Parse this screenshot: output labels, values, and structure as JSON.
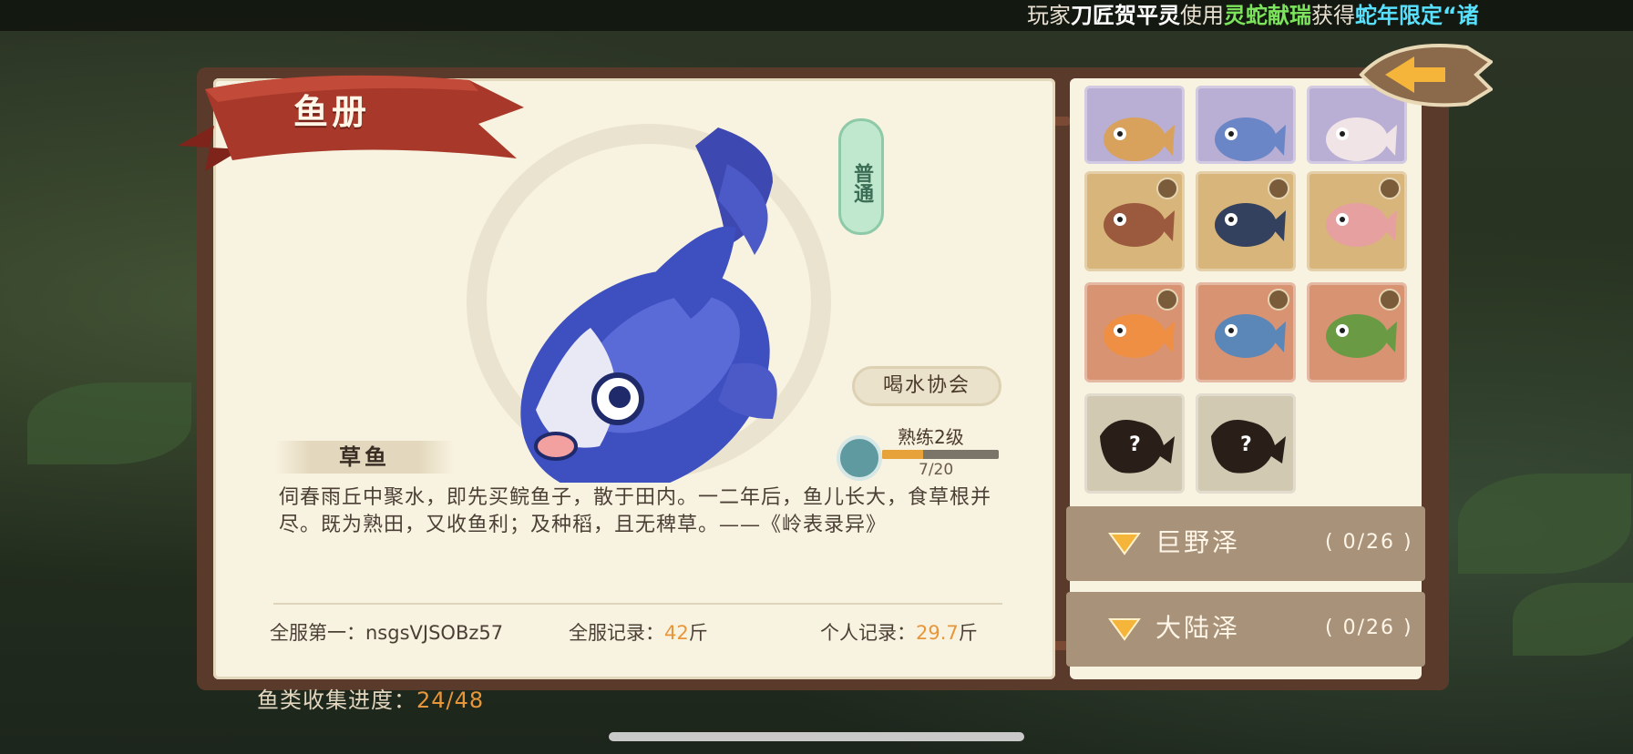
{
  "ticker": {
    "prefix": "玩家",
    "player": "刀匠贺平灵",
    "action": "使用",
    "item": "灵蛇献瑞",
    "gain": "获得",
    "reward": "蛇年限定“诸"
  },
  "book": {
    "title": "鱼册"
  },
  "fish": {
    "name": "草鱼",
    "rarity": "普通",
    "association": "喝水协会",
    "proficiency_label": "熟练2级",
    "proficiency_count": "7/20",
    "proficiency_fraction": 0.35,
    "description": "伺春雨丘中聚水，即先买鲩鱼子，散于田内。一二年后，鱼儿长大，食草根并尽。既为熟田，又收鱼利；及种稻，且无稗草。——《岭表录异》"
  },
  "stats": {
    "server_first_label": "全服第一：",
    "server_first_value": "nsgsVJSOBz57",
    "server_record_label": "全服记录：",
    "server_record_value": "42",
    "server_record_unit": "斤",
    "personal_record_label": "个人记录：",
    "personal_record_value": "29.7",
    "personal_record_unit": "斤"
  },
  "collection": {
    "label": "鱼类收集进度：",
    "value": "24/48"
  },
  "grid": {
    "cells": [
      {
        "color": "purple",
        "icon": "fish-red-lips-icon"
      },
      {
        "color": "purple",
        "icon": "fish-blue-shark-icon"
      },
      {
        "color": "purple",
        "icon": "fish-white-fox-icon"
      },
      {
        "color": "gold",
        "icon": "fish-brown-carp-icon",
        "eye": true
      },
      {
        "color": "gold",
        "icon": "fish-dark-whale-icon",
        "eye": true
      },
      {
        "color": "gold",
        "icon": "fish-dragon-icon",
        "eye": true
      },
      {
        "color": "red",
        "icon": "fish-orange-koi-icon",
        "eye": true
      },
      {
        "color": "red",
        "icon": "fish-blue-catfish-icon",
        "eye": true
      },
      {
        "color": "red",
        "icon": "fish-green-frog-icon",
        "eye": true
      },
      {
        "color": "unknown",
        "icon": "unknown-fish-icon",
        "text": "?"
      },
      {
        "color": "unknown",
        "icon": "unknown-fish-icon",
        "text": "?"
      }
    ]
  },
  "regions": [
    {
      "name": "巨野泽",
      "count": "( 0/26 )"
    },
    {
      "name": "大陆泽",
      "count": "( 0/26 )"
    }
  ],
  "colors": {
    "accent_orange": "#e8963a",
    "ribbon_red": "#a8382a",
    "rarity_green": "#bfe8cf"
  }
}
